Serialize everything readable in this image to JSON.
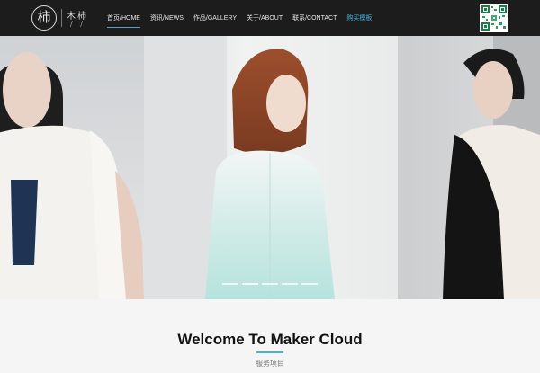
{
  "header": {
    "logo_glyph": "柿",
    "logo_name": "木柿",
    "logo_slash": "/ /",
    "nav": [
      {
        "label": "首页/HOME",
        "active": true
      },
      {
        "label": "资讯/NEWS"
      },
      {
        "label": "作品/GALLERY"
      },
      {
        "label": "关于/ABOUT"
      },
      {
        "label": "联系/CONTACT"
      },
      {
        "label": "购买模板"
      }
    ]
  },
  "colors": {
    "header_bg": "#1c1c1c",
    "accent": "#46b3e6",
    "page_bg": "#f5f5f5"
  },
  "hero": {
    "slide_count": 3,
    "active_slide": 2
  },
  "section": {
    "title": "Welcome To Maker Cloud",
    "subtitle": "服务项目"
  },
  "icons": [
    "qr-code-icon",
    "logo-mark"
  ]
}
